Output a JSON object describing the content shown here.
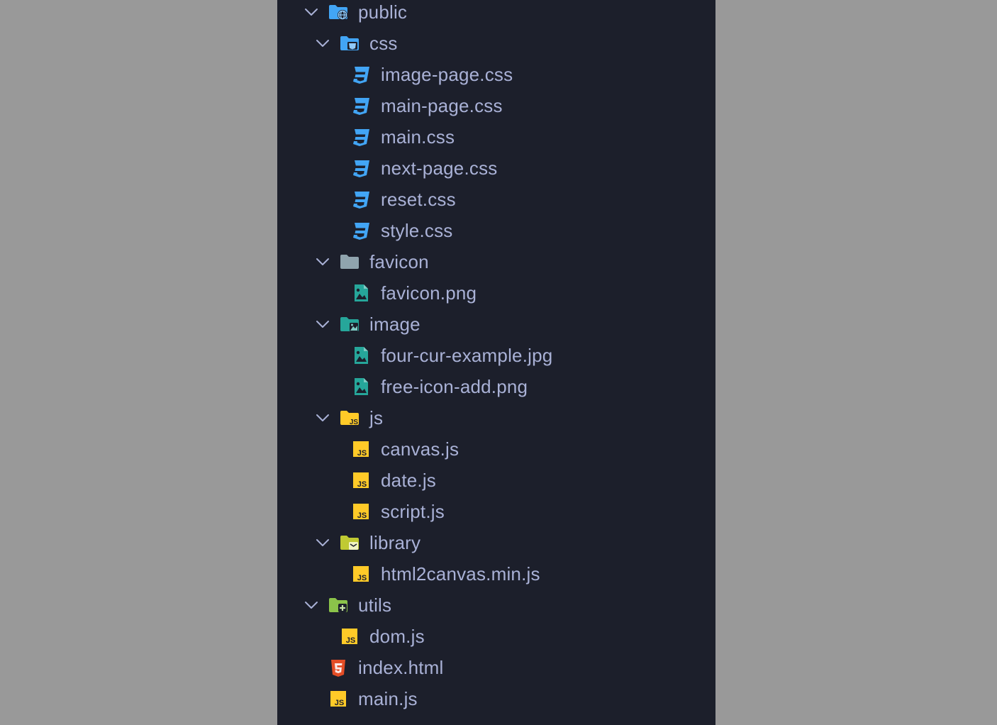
{
  "tree": [
    {
      "label": "public",
      "kind": "folder",
      "icon": "folder-public-icon",
      "depth": 0,
      "expanded": true
    },
    {
      "label": "css",
      "kind": "folder",
      "icon": "folder-css-icon",
      "depth": 1,
      "expanded": true
    },
    {
      "label": "image-page.css",
      "kind": "file",
      "icon": "css-file-icon",
      "depth": 2
    },
    {
      "label": "main-page.css",
      "kind": "file",
      "icon": "css-file-icon",
      "depth": 2
    },
    {
      "label": "main.css",
      "kind": "file",
      "icon": "css-file-icon",
      "depth": 2
    },
    {
      "label": "next-page.css",
      "kind": "file",
      "icon": "css-file-icon",
      "depth": 2
    },
    {
      "label": "reset.css",
      "kind": "file",
      "icon": "css-file-icon",
      "depth": 2
    },
    {
      "label": "style.css",
      "kind": "file",
      "icon": "css-file-icon",
      "depth": 2
    },
    {
      "label": "favicon",
      "kind": "folder",
      "icon": "folder-icon",
      "depth": 1,
      "expanded": true
    },
    {
      "label": "favicon.png",
      "kind": "file",
      "icon": "image-file-icon",
      "depth": 2
    },
    {
      "label": "image",
      "kind": "folder",
      "icon": "folder-image-icon",
      "depth": 1,
      "expanded": true
    },
    {
      "label": "four-cur-example.jpg",
      "kind": "file",
      "icon": "image-file-icon",
      "depth": 2
    },
    {
      "label": "free-icon-add.png",
      "kind": "file",
      "icon": "image-file-icon",
      "depth": 2
    },
    {
      "label": "js",
      "kind": "folder",
      "icon": "folder-js-icon",
      "depth": 1,
      "expanded": true
    },
    {
      "label": "canvas.js",
      "kind": "file",
      "icon": "js-file-icon",
      "depth": 2
    },
    {
      "label": "date.js",
      "kind": "file",
      "icon": "js-file-icon",
      "depth": 2
    },
    {
      "label": "script.js",
      "kind": "file",
      "icon": "js-file-icon",
      "depth": 2
    },
    {
      "label": "library",
      "kind": "folder",
      "icon": "folder-library-icon",
      "depth": 1,
      "expanded": true
    },
    {
      "label": "html2canvas.min.js",
      "kind": "file",
      "icon": "js-file-icon",
      "depth": 2
    },
    {
      "label": "utils",
      "kind": "folder",
      "icon": "folder-utils-icon",
      "depth": 0,
      "expanded": true
    },
    {
      "label": "dom.js",
      "kind": "file",
      "icon": "js-file-icon",
      "depth": 1
    },
    {
      "label": "index.html",
      "kind": "file",
      "icon": "html-file-icon",
      "depth": 0
    },
    {
      "label": "main.js",
      "kind": "file",
      "icon": "js-file-icon",
      "depth": 0
    }
  ],
  "colors": {
    "panel_bg": "#1c1f2b",
    "page_bg": "#999999",
    "text": "#a9b1d6",
    "chevron": "#a9b1d6",
    "css_blue": "#42a5f5",
    "image_teal": "#26a69a",
    "js_yellow": "#ffca28",
    "html_orange": "#e44d26",
    "folder_gray": "#90a4ae",
    "folder_blue": "#42a5f5",
    "folder_lime": "#c0ca33",
    "folder_green": "#8bc34a"
  }
}
